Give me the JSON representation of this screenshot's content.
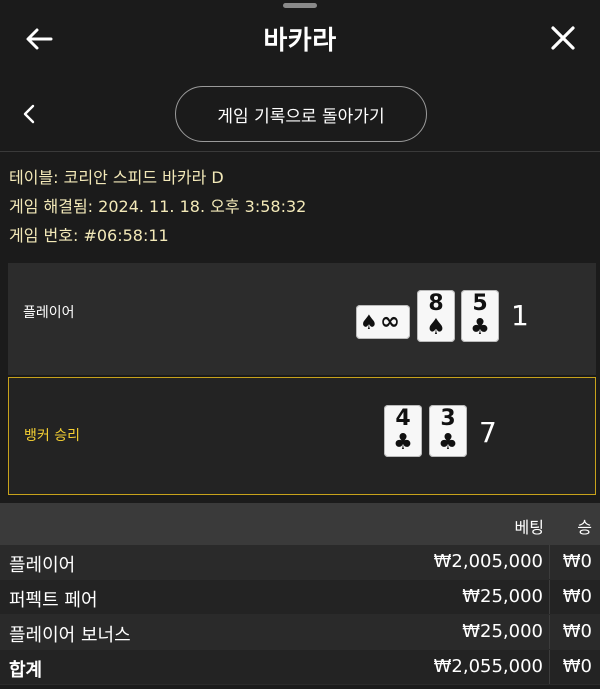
{
  "header": {
    "title": "바카라",
    "back_icon": "arrow-left-icon",
    "close_icon": "close-icon"
  },
  "nav": {
    "back_icon": "chevron-left-icon",
    "history_button_label": "게임 기록으로 돌아가기"
  },
  "info": {
    "table": "테이블: 코리안 스피드 바카라 D",
    "resolved": "게임 해결됨: 2024. 11. 18. 오후 3:58:32",
    "game_number": "게임 번호: #06:58:11"
  },
  "hands": {
    "player": {
      "label": "플레이어",
      "score": "1",
      "cards": [
        {
          "rank": "∞",
          "suit": "♠",
          "style": "squeeze"
        },
        {
          "rank": "8",
          "suit": "♠"
        },
        {
          "rank": "5",
          "suit": "♣"
        }
      ]
    },
    "banker": {
      "label": "뱅커 승리",
      "score": "7",
      "cards": [
        {
          "rank": "4",
          "suit": "♣"
        },
        {
          "rank": "3",
          "suit": "♣"
        }
      ]
    }
  },
  "bets": {
    "columns": {
      "bet": "베팅",
      "win": "승"
    },
    "rows": [
      {
        "name": "플레이어",
        "bet": "₩2,005,000",
        "win": "₩0"
      },
      {
        "name": "퍼펙트 페어",
        "bet": "₩25,000",
        "win": "₩0"
      },
      {
        "name": "플레이어 보너스",
        "bet": "₩25,000",
        "win": "₩0"
      }
    ],
    "total": {
      "name": "합계",
      "bet": "₩2,055,000",
      "win": "₩0"
    }
  },
  "colors": {
    "background": "#1b1b1b",
    "info_text": "#f3e9b8",
    "banker_accent": "#c7a21b",
    "banker_label": "#f5d033"
  }
}
